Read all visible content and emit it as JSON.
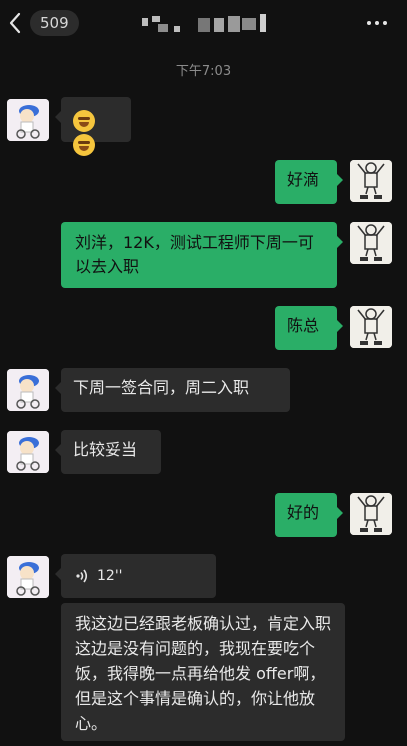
{
  "header": {
    "back_count": "509",
    "title": "",
    "colors": {
      "background": "#111111"
    },
    "icons": {
      "back": "chevron-left-icon",
      "more": "more-dots-icon"
    }
  },
  "chat": {
    "timestamp": "下午7:03",
    "messages": [
      {
        "side": "in",
        "type": "emoji",
        "text": ""
      },
      {
        "side": "out",
        "type": "text",
        "text": "好滴"
      },
      {
        "side": "out",
        "type": "text",
        "text": "刘洋，12K，测试工程师下周一可以去入职"
      },
      {
        "side": "out",
        "type": "text",
        "text": "陈总"
      },
      {
        "side": "in",
        "type": "text",
        "text": "下周一签合同，周二入职"
      },
      {
        "side": "in",
        "type": "text",
        "text": "比较妥当"
      },
      {
        "side": "out",
        "type": "text",
        "text": "好的"
      },
      {
        "side": "in",
        "type": "voice",
        "text": "12''"
      },
      {
        "side": "in",
        "type": "voice_transcript",
        "text": "我这边已经跟老板确认过，肯定入职这边是没有问题的，我现在要吃个饭，我得晚一点再给他发 offer啊，但是这个事情是确认的，你让他放心。"
      }
    ],
    "colors": {
      "incoming": "#2c2c2c",
      "outgoing": "#2aae67"
    }
  }
}
